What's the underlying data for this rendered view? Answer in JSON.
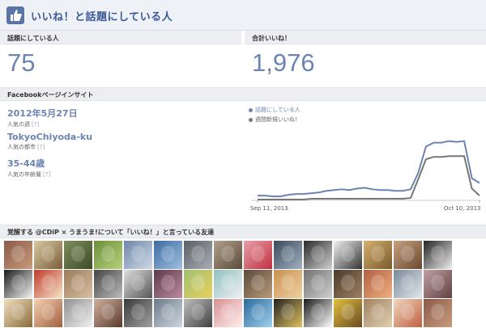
{
  "header": {
    "title": "いいね！と話題にしている人"
  },
  "stats": {
    "talking_label": "話題にしている人",
    "talking_value": "75",
    "likes_label": "合計いいね！",
    "likes_value": "1,976"
  },
  "insight": {
    "title": "Facebookページインサイト",
    "items": [
      {
        "value": "2012年5月27日",
        "label": "人気の週",
        "q": "[?]"
      },
      {
        "value": "TokyoChiyoda-ku",
        "label": "人気の都市",
        "q": "[?]"
      },
      {
        "value": "35-44歳",
        "label": "人気の年齢層",
        "q": "[?]"
      }
    ]
  },
  "chart_data": {
    "type": "line",
    "x": [
      "Sep 11, 2013",
      "",
      "",
      "",
      "",
      "",
      "",
      "",
      "",
      "",
      "",
      "",
      "",
      "",
      "",
      "",
      "",
      "",
      "",
      "",
      "",
      "",
      "",
      "",
      "",
      "",
      "",
      "",
      "",
      "Oct 10, 2013"
    ],
    "xticks": [
      "Sep 11, 2013",
      "Oct 10, 2013"
    ],
    "series": [
      {
        "name": "話題にしている人",
        "color": "#6b84b4",
        "values": [
          6,
          6,
          5,
          5,
          7,
          8,
          8,
          9,
          10,
          12,
          13,
          14,
          13,
          15,
          16,
          14,
          13,
          13,
          12,
          12,
          14,
          35,
          68,
          73,
          73,
          75,
          74,
          75,
          28,
          22
        ]
      },
      {
        "name": "週間新規いいね！",
        "color": "#777777",
        "values": [
          1,
          1,
          1,
          1,
          1,
          1,
          1,
          2,
          2,
          2,
          2,
          2,
          2,
          2,
          2,
          2,
          2,
          2,
          2,
          2,
          3,
          27,
          52,
          55,
          55,
          56,
          56,
          56,
          15,
          6
        ]
      }
    ],
    "ylim": [
      0,
      90
    ]
  },
  "friends": {
    "title": "覚醒する @CDiP × うまうま!について「いいね！」と言っている友達"
  },
  "colors": {
    "accent": "#3b5998",
    "number": "#6b84b4"
  }
}
